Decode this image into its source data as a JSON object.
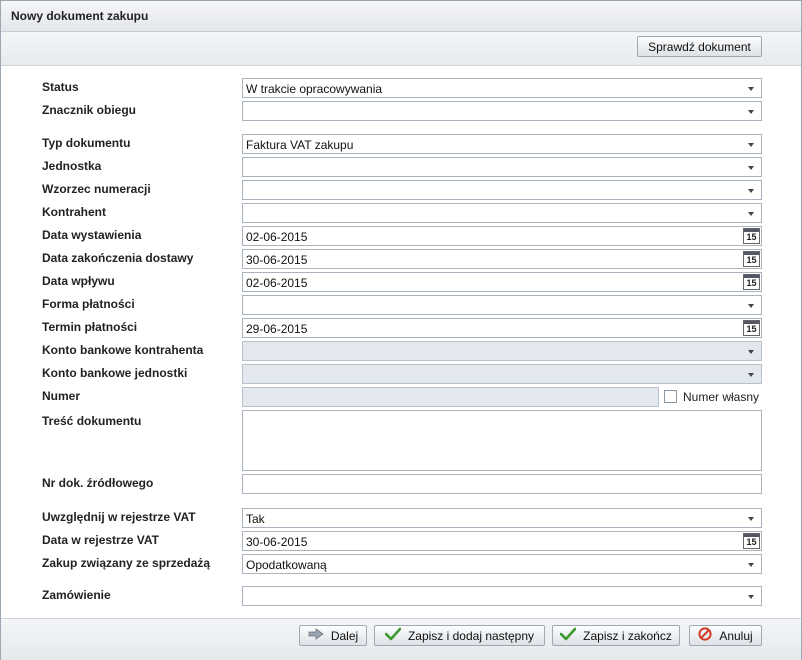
{
  "window": {
    "title": "Nowy dokument zakupu"
  },
  "toolbar": {
    "check_label": "Sprawdź dokument"
  },
  "form": {
    "status": {
      "label": "Status",
      "value": "W trakcie opracowywania"
    },
    "flow_marker": {
      "label": "Znacznik obiegu",
      "value": ""
    },
    "doc_type": {
      "label": "Typ dokumentu",
      "value": "Faktura VAT zakupu"
    },
    "unit": {
      "label": "Jednostka",
      "value": ""
    },
    "numbering": {
      "label": "Wzorzec numeracji",
      "value": ""
    },
    "contractor": {
      "label": "Kontrahent",
      "value": ""
    },
    "issue_date": {
      "label": "Data wystawienia",
      "value": "02-06-2015"
    },
    "delivery_date": {
      "label": "Data zakończenia dostawy",
      "value": "30-06-2015"
    },
    "receipt_date": {
      "label": "Data wpływu",
      "value": "02-06-2015"
    },
    "payment_form": {
      "label": "Forma płatności",
      "value": ""
    },
    "payment_due": {
      "label": "Termin płatności",
      "value": "29-06-2015"
    },
    "contractor_account": {
      "label": "Konto bankowe kontrahenta",
      "value": ""
    },
    "unit_account": {
      "label": "Konto bankowe jednostki",
      "value": ""
    },
    "number": {
      "label": "Numer",
      "value": "",
      "own_number_label": "Numer własny"
    },
    "content": {
      "label": "Treść dokumentu",
      "value": ""
    },
    "source_doc_no": {
      "label": "Nr dok. źródłowego",
      "value": ""
    },
    "vat_register": {
      "label": "Uwzględnij w rejestrze VAT",
      "value": "Tak"
    },
    "vat_register_date": {
      "label": "Data w rejestrze VAT",
      "value": "30-06-2015"
    },
    "sale_related": {
      "label": "Zakup związany ze sprzedażą",
      "value": "Opodatkowaną"
    },
    "order": {
      "label": "Zamówienie",
      "value": ""
    }
  },
  "calendar_day": "15",
  "footer": {
    "next_label": "Dalej",
    "save_new_label": "Zapisz i dodaj następny",
    "save_close_label": "Zapisz i zakończ",
    "cancel_label": "Anuluj"
  }
}
